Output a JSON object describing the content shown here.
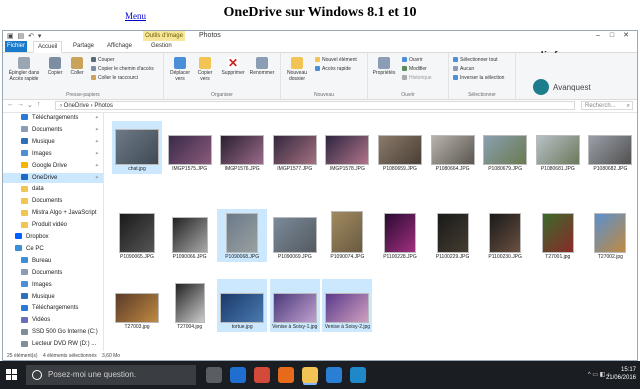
{
  "page": {
    "menu_link": "Menu",
    "title": "OneDrive sur Windows 8.1 et 10"
  },
  "window": {
    "contextual_tab": "Outils d'image",
    "title": "Photos",
    "ribbon_tabs": [
      "Fichier",
      "Accueil",
      "Partage",
      "Affichage",
      "Gestion"
    ],
    "groups": {
      "clipboard": {
        "label": "Presse-papiers",
        "pin": "Épingler dans Accès rapide",
        "copy": "Copier",
        "paste": "Coller",
        "cut": "Couper",
        "copy_path": "Copier le chemin d'accès",
        "paste_shortcut": "Coller le raccourci"
      },
      "organize": {
        "label": "Organiser",
        "move": "Déplacer vers",
        "copy_to": "Copier vers",
        "delete": "Supprimer",
        "rename": "Renommer"
      },
      "new": {
        "label": "Nouveau",
        "new_folder": "Nouveau dossier",
        "new_item": "Nouvel élément",
        "easy_access": "Accès rapide"
      },
      "open": {
        "label": "Ouvrir",
        "properties": "Propriétés",
        "open": "Ouvrir",
        "modify": "Modifier",
        "history": "Historique"
      },
      "select": {
        "label": "Sélectionner",
        "select_all": "Sélectionner tout",
        "select_none": "Aucun",
        "invert": "Inverser la sélection"
      }
    },
    "watermark": "www.mediaforma.com",
    "brand": "Avanquest",
    "address": {
      "path": "› OneDrive › Photos",
      "search_placeholder": "Recherch..."
    },
    "nav": [
      {
        "label": "Téléchargements",
        "icon": "download-icon",
        "color": "#2b7bd6",
        "pinned": true
      },
      {
        "label": "Documents",
        "icon": "documents-icon",
        "color": "#8a9db5",
        "pinned": true
      },
      {
        "label": "Musique",
        "icon": "music-icon",
        "color": "#2f6fb8",
        "pinned": true
      },
      {
        "label": "Images",
        "icon": "images-icon",
        "color": "#4a8fd8",
        "pinned": true
      },
      {
        "label": "Google Drive",
        "icon": "google-drive-icon",
        "color": "#f4b400",
        "pinned": true
      },
      {
        "label": "OneDrive",
        "icon": "onedrive-icon",
        "color": "#1b6ac9",
        "pinned": true,
        "selected": true
      },
      {
        "label": "data",
        "icon": "folder-icon",
        "color": "#f1c453"
      },
      {
        "label": "Documents",
        "icon": "folder-icon",
        "color": "#f1c453"
      },
      {
        "label": "Mistra Algo + JavaScript",
        "icon": "folder-icon",
        "color": "#f1c453"
      },
      {
        "label": "Produit vidéo",
        "icon": "folder-icon",
        "color": "#f1c453"
      },
      {
        "label": "Dropbox",
        "icon": "dropbox-icon",
        "color": "#0061fe"
      },
      {
        "label": "Ce PC",
        "icon": "pc-icon",
        "color": "#3b8fd9"
      },
      {
        "label": "Bureau",
        "icon": "desktop-icon",
        "color": "#3b8fd9"
      },
      {
        "label": "Documents",
        "icon": "documents-icon",
        "color": "#8a9db5"
      },
      {
        "label": "Images",
        "icon": "images-icon",
        "color": "#4a8fd8"
      },
      {
        "label": "Musique",
        "icon": "music-icon",
        "color": "#2f6fb8"
      },
      {
        "label": "Téléchargements",
        "icon": "download-icon",
        "color": "#2b7bd6"
      },
      {
        "label": "Vidéos",
        "icon": "videos-icon",
        "color": "#6b6fb8"
      },
      {
        "label": "SSD 500 Go Interne (C:)",
        "icon": "drive-icon",
        "color": "#7f8c99"
      },
      {
        "label": "Lecteur DVD RW (D:) ...",
        "icon": "dvd-icon",
        "color": "#7f8c99"
      }
    ],
    "files": [
      {
        "name": "chat.jpg",
        "selected": true,
        "tone": [
          "#6d7a86",
          "#3f4a55"
        ],
        "w": 44,
        "h": 36
      },
      {
        "name": "IMGP1575.JPG",
        "tone": [
          "#3a2a4a",
          "#8a5a7a"
        ],
        "w": 44,
        "h": 30
      },
      {
        "name": "IMGP1576.JPG",
        "tone": [
          "#2a2030",
          "#9a6a8a"
        ],
        "w": 44,
        "h": 30
      },
      {
        "name": "IMGP1577.JPG",
        "tone": [
          "#35283e",
          "#a3707f"
        ],
        "w": 44,
        "h": 30
      },
      {
        "name": "IMGP1578.JPG",
        "tone": [
          "#2e2540",
          "#b0748a"
        ],
        "w": 44,
        "h": 30
      },
      {
        "name": "P1080659.JPG",
        "tone": [
          "#8a7a6a",
          "#4a3f35"
        ],
        "w": 44,
        "h": 30
      },
      {
        "name": "P1080664.JPG",
        "tone": [
          "#b8b4ac",
          "#5a5550"
        ],
        "w": 44,
        "h": 30
      },
      {
        "name": "P1080679.JPG",
        "tone": [
          "#8aa0b0",
          "#6a7a50"
        ],
        "w": 44,
        "h": 30
      },
      {
        "name": "P1080681.JPG",
        "tone": [
          "#b8c0c8",
          "#6a7a5a"
        ],
        "w": 44,
        "h": 30
      },
      {
        "name": "P1080682.JPG",
        "tone": [
          "#9aa0a8",
          "#505050"
        ],
        "w": 44,
        "h": 30
      },
      {
        "name": "P1090065.JPG",
        "tone": [
          "#1a1a1a",
          "#555555"
        ],
        "w": 36,
        "h": 40
      },
      {
        "name": "P1090066.JPG",
        "tone": [
          "#222222",
          "#aaaaaa"
        ],
        "w": 36,
        "h": 36
      },
      {
        "name": "P1090068.JPG",
        "selected": true,
        "tone": [
          "#6a7a8a",
          "#9aa0a0"
        ],
        "w": 32,
        "h": 40
      },
      {
        "name": "P1090069.JPG",
        "tone": [
          "#7a8a9a",
          "#555a60"
        ],
        "w": 44,
        "h": 36
      },
      {
        "name": "P1090074.JPG",
        "tone": [
          "#a08a60",
          "#6a5a40"
        ],
        "w": 32,
        "h": 42
      },
      {
        "name": "P1100228.JPG",
        "tone": [
          "#2a0a30",
          "#a03080"
        ],
        "w": 32,
        "h": 40
      },
      {
        "name": "P1100229.JPG",
        "tone": [
          "#1a1a1a",
          "#443c30"
        ],
        "w": 32,
        "h": 40
      },
      {
        "name": "P1100230.JPG",
        "tone": [
          "#1a1a1a",
          "#6a5040"
        ],
        "w": 32,
        "h": 40
      },
      {
        "name": "T27001.jpg",
        "tone": [
          "#3a6a2a",
          "#8a2a2a"
        ],
        "w": 32,
        "h": 40
      },
      {
        "name": "T27002.jpg",
        "tone": [
          "#5a90d0",
          "#c08a40"
        ],
        "w": 32,
        "h": 40
      },
      {
        "name": "T27003.jpg",
        "tone": [
          "#5a3a2a",
          "#c08a40"
        ],
        "w": 44,
        "h": 30
      },
      {
        "name": "T27004.jpg",
        "tone": [
          "#222222",
          "#cccccc"
        ],
        "w": 30,
        "h": 40
      },
      {
        "name": "tortue.jpg",
        "selected": true,
        "tone": [
          "#1a3a6a",
          "#4a7ab0"
        ],
        "w": 44,
        "h": 30
      },
      {
        "name": "Venise à Soisy-1.jpg",
        "selected": true,
        "tone": [
          "#4a3a7a",
          "#c0a0d0"
        ],
        "w": 44,
        "h": 30
      },
      {
        "name": "Venise à Soisy-2.jpg",
        "selected": true,
        "tone": [
          "#5a3a8a",
          "#d0a0c0"
        ],
        "w": 44,
        "h": 30
      }
    ],
    "status": {
      "count": "25 élément(s)",
      "selection": "4 éléments sélectionnés",
      "size": "3,60 Mo"
    }
  },
  "taskbar": {
    "search_placeholder": "Posez-moi une question.",
    "apps": [
      {
        "name": "task-view",
        "color": "#5a5d62"
      },
      {
        "name": "edge",
        "color": "#1e6fd0"
      },
      {
        "name": "chrome",
        "color": "#d44a3a"
      },
      {
        "name": "firefox",
        "color": "#e66a1a"
      },
      {
        "name": "explorer",
        "color": "#f1c453"
      },
      {
        "name": "store",
        "color": "#2a7fd4"
      },
      {
        "name": "photos",
        "color": "#1e88c8"
      }
    ],
    "time": "15:17",
    "date": "21/06/2016"
  }
}
